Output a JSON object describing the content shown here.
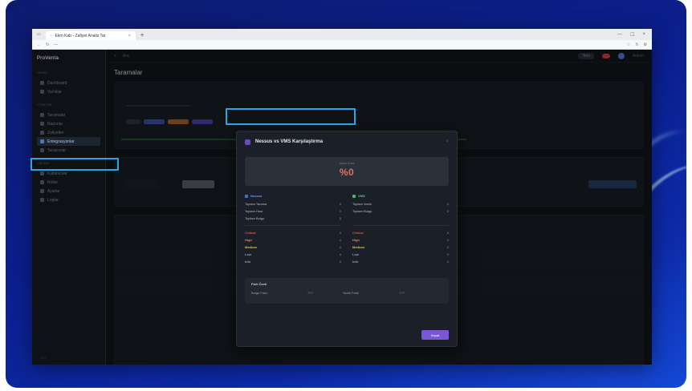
{
  "browser": {
    "tab_title": "Ekrn Kab - Zafiyet Analiz Tar",
    "tab_close": "×",
    "new_tab": "+",
    "window_controls": [
      "—",
      "☐",
      "×"
    ],
    "address": "—",
    "address_icons": [
      "☆",
      "↻",
      "⚙"
    ]
  },
  "sidebar": {
    "logo": "ProVenta",
    "groups": [
      "GENEL",
      "YÖNETİM",
      "SİSTEM"
    ],
    "items": [
      {
        "label": "Dashboard"
      },
      {
        "label": "Varlıklar"
      },
      {
        "label": "Taramalar"
      },
      {
        "label": "Raporlar"
      },
      {
        "label": "Zafiyetler"
      },
      {
        "label": "Entegrasyonlar"
      },
      {
        "label": "Tarayıcılar"
      },
      {
        "label": "Kullanıcılar"
      },
      {
        "label": "Roller"
      },
      {
        "label": "Ayarlar"
      },
      {
        "label": "Loglar"
      }
    ],
    "footer": "v1.0"
  },
  "topbar": {
    "search": "Ara",
    "pill": "Yeni",
    "user": "Admin"
  },
  "page": {
    "title": "Taramalar"
  },
  "modal": {
    "title": "Nessus vs VMS Karşılaştırma",
    "close": "×",
    "score_label": "Uyum Oranı",
    "score_value": "%0",
    "left": {
      "name": "Nessus",
      "color": "#3f6fd8",
      "rows": [
        {
          "k": "Toplam Tarama",
          "v": "0"
        },
        {
          "k": "Toplam Host",
          "v": "0"
        },
        {
          "k": "Toplam Bulgu",
          "v": "0"
        }
      ],
      "severity": [
        {
          "k": "Critical",
          "v": "0",
          "color": "#e0524f"
        },
        {
          "k": "High",
          "v": "0",
          "color": "#e8833a"
        },
        {
          "k": "Medium",
          "v": "0",
          "color": "#e3c23b"
        },
        {
          "k": "Low",
          "v": "0",
          "color": "#8fa0b4"
        },
        {
          "k": "Info",
          "v": "0",
          "color": "#8fa0b4"
        }
      ]
    },
    "right": {
      "name": "VMS",
      "color": "#3cbf6a",
      "rows": [
        {
          "k": "Toplam Varlık",
          "v": "0"
        },
        {
          "k": "Toplam Bulgu",
          "v": "0"
        }
      ],
      "severity": [
        {
          "k": "Critical",
          "v": "0",
          "color": "#e0524f"
        },
        {
          "k": "High",
          "v": "0",
          "color": "#e8833a"
        },
        {
          "k": "Medium",
          "v": "0",
          "color": "#e3c23b"
        },
        {
          "k": "Low",
          "v": "0",
          "color": "#8fa0b4"
        },
        {
          "k": "Info",
          "v": "0",
          "color": "#8fa0b4"
        }
      ]
    },
    "summary": {
      "title": "Fark Özeti",
      "left_label": "Bulgu Farkı",
      "left_value": "???",
      "right_label": "Varlık Farkı",
      "right_value": "???"
    },
    "close_button": "Kapat"
  },
  "table_values": [
    "???",
    "???",
    "???",
    "???"
  ]
}
